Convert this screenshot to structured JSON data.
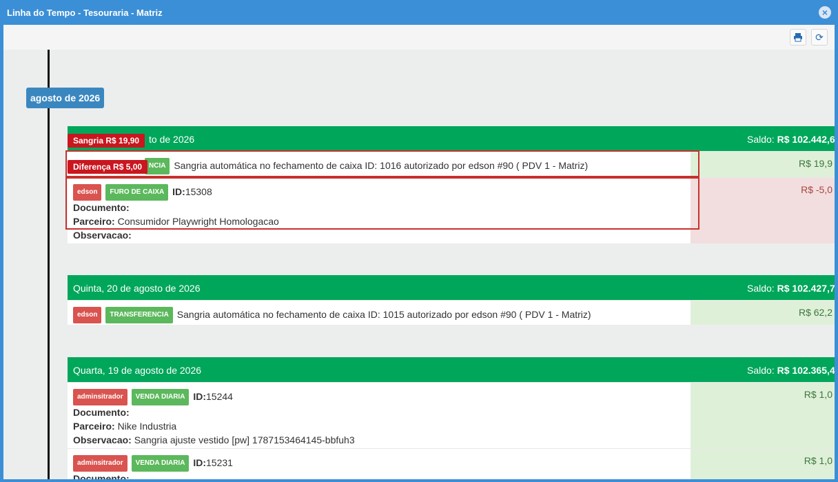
{
  "window": {
    "title": "Linha do Tempo - Tesouraria - Matriz"
  },
  "icons": {
    "close": "close-icon",
    "print": "print-icon",
    "refresh": "refresh-icon"
  },
  "timeline": {
    "month_label": "agosto de 2026"
  },
  "cards": [
    {
      "date": "to de 2026",
      "saldo_label": "Saldo:",
      "saldo_value": "R$ 102.442,6",
      "rows": [
        {
          "user": "",
          "type": "NCIA",
          "line1_value": "Sangria automática no fechamento de caixa ID: 1016 autorizado por edson #90 ( PDV 1 - Matriz)",
          "amount": "R$ 19,9",
          "sign": "pos"
        },
        {
          "user": "edson",
          "type": "FURO DE CAIXA",
          "id_label": "ID:",
          "id_value": "15308",
          "documento_label": "Documento:",
          "parceiro_label": "Parceiro:",
          "parceiro_value": "Consumidor Playwright Homologacao",
          "observacao_label": "Observacao:",
          "amount": "R$ -5,0",
          "sign": "neg"
        }
      ]
    },
    {
      "date": "Quinta, 20 de agosto de 2026",
      "saldo_label": "Saldo:",
      "saldo_value": "R$ 102.427,7",
      "rows": [
        {
          "user": "edson",
          "type": "TRANSFERENCIA",
          "line1_value": "Sangria automática no fechamento de caixa ID: 1015 autorizado por edson #90 ( PDV 1 - Matriz)",
          "amount": "R$ 62,2",
          "sign": "pos"
        }
      ]
    },
    {
      "date": "Quarta, 19 de agosto de 2026",
      "saldo_label": "Saldo:",
      "saldo_value": "R$ 102.365,4",
      "rows": [
        {
          "user": "adminsitrador",
          "type": "VENDA DIARIA",
          "id_label": "ID:",
          "id_value": "15244",
          "documento_label": "Documento:",
          "parceiro_label": "Parceiro:",
          "parceiro_value": "Nike Industria",
          "observacao_label": "Observacao:",
          "observacao_value": "Sangria ajuste vestido [pw] 1787153464145-bbfuh3",
          "amount": "R$ 1,0",
          "sign": "pos"
        },
        {
          "user": "adminsitrador",
          "type": "VENDA DIARIA",
          "id_label": "ID:",
          "id_value": "15231",
          "documento_label": "Documento:",
          "amount": "R$ 1,0",
          "sign": "pos"
        }
      ]
    }
  ],
  "annotations": {
    "sangria": "Sangria R$ 19,90",
    "diferenca": "Diferença R$ 5,00"
  }
}
